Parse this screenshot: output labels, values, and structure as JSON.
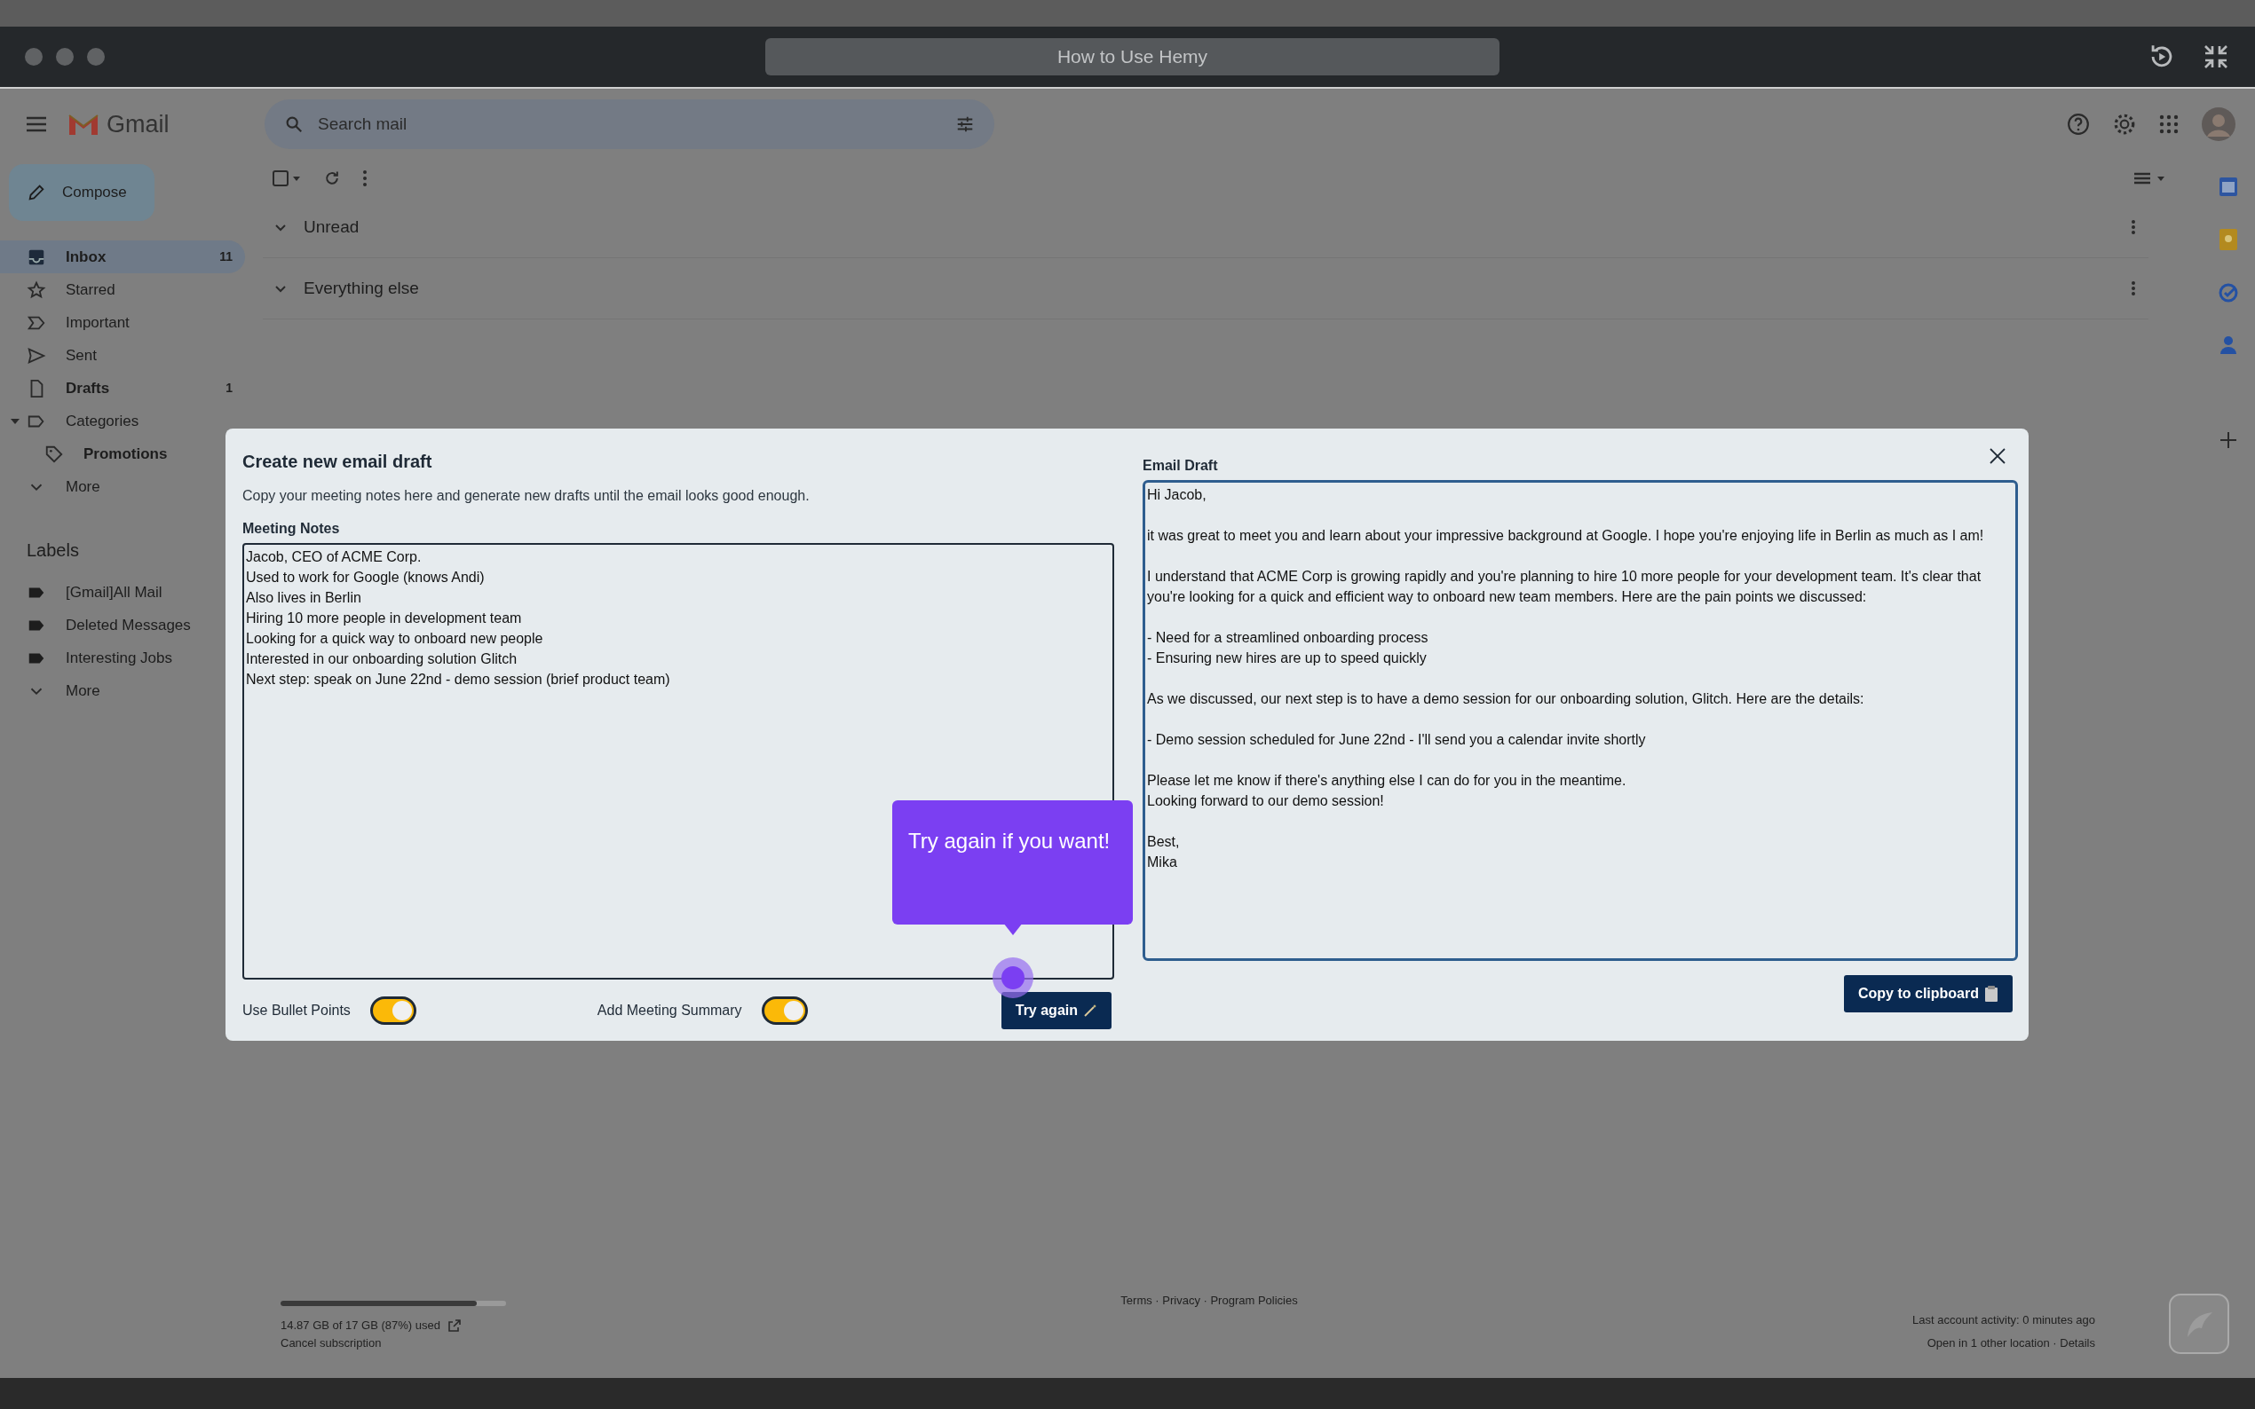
{
  "window": {
    "title": "How to Use Hemy"
  },
  "gmail": {
    "brand": "Gmail",
    "search": {
      "placeholder": "Search mail"
    },
    "compose": "Compose",
    "nav": [
      {
        "kind": "inbox",
        "label": "Inbox",
        "count": "11",
        "selected": true,
        "unread": true
      },
      {
        "kind": "star",
        "label": "Starred",
        "selected": false,
        "unread": false
      },
      {
        "kind": "important",
        "label": "Important",
        "selected": false,
        "unread": false
      },
      {
        "kind": "sent",
        "label": "Sent",
        "selected": false,
        "unread": false
      },
      {
        "kind": "draft",
        "label": "Drafts",
        "count": "1",
        "selected": false,
        "unread": true
      },
      {
        "kind": "category",
        "label": "Categories",
        "selected": false,
        "unread": false,
        "expanded": true,
        "children": [
          {
            "kind": "tag",
            "label": "Promotions",
            "selected": false,
            "unread": true
          }
        ]
      },
      {
        "kind": "more",
        "label": "More",
        "selected": false,
        "unread": false
      }
    ],
    "labels_title": "Labels",
    "labels": [
      {
        "kind": "label",
        "label": "[Gmail]All Mail"
      },
      {
        "kind": "label",
        "label": "Deleted Messages"
      },
      {
        "kind": "label",
        "label": "Interesting Jobs"
      },
      {
        "kind": "more",
        "label": "More"
      }
    ],
    "sections": [
      "Unread",
      "Everything else"
    ],
    "storage": {
      "text": "14.87 GB of 17 GB (87%) used",
      "level": 0.87,
      "cancel": "Cancel subscription"
    },
    "footer_links": "Terms · Privacy · Program Policies",
    "activity": [
      "Last account activity: 0 minutes ago",
      "Open in 1 other location · Details"
    ]
  },
  "modal": {
    "title": "Create new email draft",
    "subtitle": "Copy your meeting notes here and generate new drafts until the email looks good enough.",
    "notes_label": "Meeting Notes",
    "notes": "Jacob, CEO of ACME Corp.\nUsed to work for Google (knows Andi)\nAlso lives in Berlin\nHiring 10 more people in development team\nLooking for a quick way to onboard new people\nInterested in our onboarding solution Glitch\nNext step: speak on June 22nd - demo session (brief product team)",
    "draft_label": "Email Draft",
    "draft": "Hi Jacob,\n\nit was great to meet you and learn about your impressive background at Google. I hope you're enjoying life in Berlin as much as I am!\n\nI understand that ACME Corp is growing rapidly and you're planning to hire 10 more people for your development team. It's clear that you're looking for a quick and efficient way to onboard new team members. Here are the pain points we discussed:\n\n- Need for a streamlined onboarding process\n- Ensuring new hires are up to speed quickly\n\nAs we discussed, our next step is to have a demo session for our onboarding solution, Glitch. Here are the details:\n\n- Demo session scheduled for June 22nd - I'll send you a calendar invite shortly\n\nPlease let me know if there's anything else I can do for you in the meantime.\nLooking forward to our demo session!\n\nBest,\nMika",
    "toggles": [
      {
        "label": "Use Bullet Points",
        "on": true
      },
      {
        "label": "Add Meeting Summary",
        "on": true
      }
    ],
    "retry_button": "Try again",
    "copy_button": "Copy to clipboard",
    "tooltip": "Try again if you want!"
  }
}
